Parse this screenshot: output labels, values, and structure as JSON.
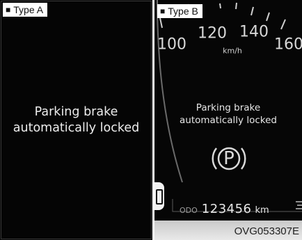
{
  "panel_a": {
    "label": "Type A",
    "message_line1": "Parking brake",
    "message_line2": "automatically locked"
  },
  "panel_b": {
    "label": "Type B",
    "speed_marks": [
      "100",
      "120",
      "140",
      "160"
    ],
    "speed_unit": "km/h",
    "message_line1": "Parking brake",
    "message_line2": "automatically locked",
    "parking_symbol": "P",
    "odometer_label": "ODO",
    "odometer_value": "123456",
    "odometer_unit": "km",
    "icon": "parking-brake-warning-icon"
  },
  "figure_code": "OVG053307E"
}
